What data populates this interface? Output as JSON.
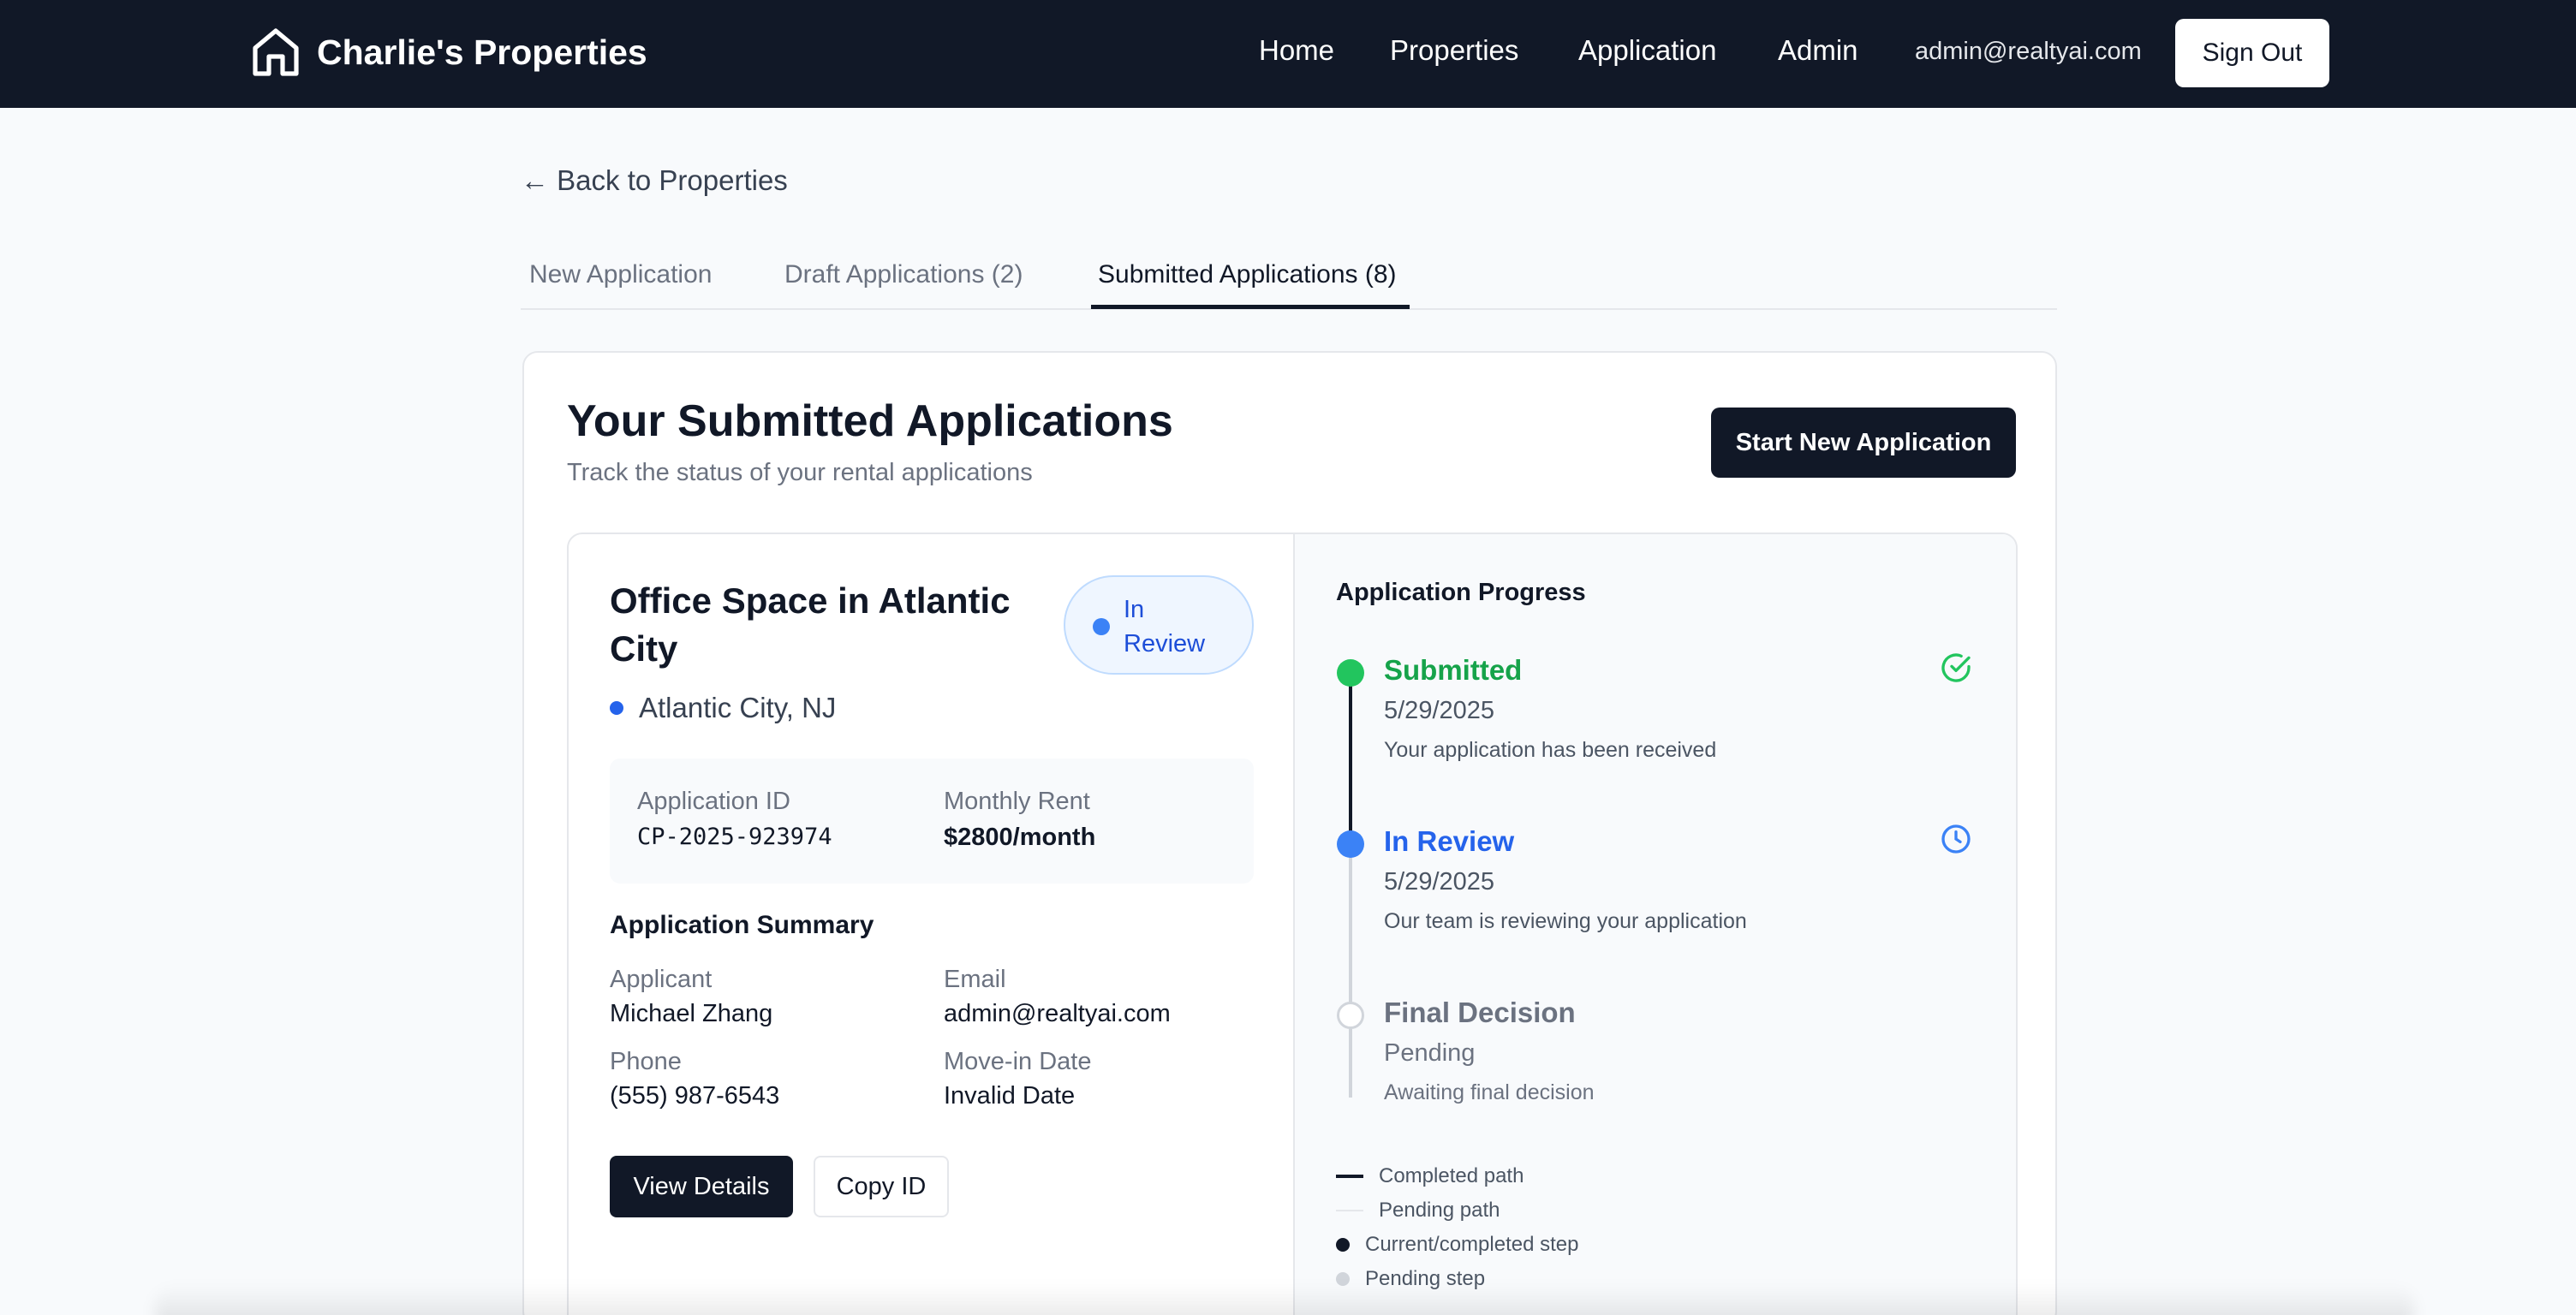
{
  "navbar": {
    "brand": "Charlie's Properties",
    "links": [
      "Home",
      "Properties",
      "Application",
      "Admin"
    ],
    "user_email": "admin@realtyai.com",
    "sign_out": "Sign Out"
  },
  "back_link": "← Back to Properties",
  "tabs": [
    {
      "label": "New Application",
      "active": false
    },
    {
      "label": "Draft Applications (2)",
      "active": false
    },
    {
      "label": "Submitted Applications (8)",
      "active": true
    }
  ],
  "page": {
    "title": "Your Submitted Applications",
    "subtitle": "Track the status of your rental applications",
    "start_button": "Start New Application"
  },
  "application": {
    "property": "Office Space in Atlantic City",
    "status": "In Review",
    "location": "Atlantic City, NJ",
    "id_label": "Application ID",
    "id_value": "CP-2025-923974",
    "rent_label": "Monthly Rent",
    "rent_value": "$2800/month",
    "summary_heading": "Application Summary",
    "applicant_label": "Applicant",
    "applicant_value": "Michael Zhang",
    "email_label": "Email",
    "email_value": "admin@realtyai.com",
    "phone_label": "Phone",
    "phone_value": "(555) 987-6543",
    "movein_label": "Move-in Date",
    "movein_value": "Invalid Date",
    "view_button": "View Details",
    "copy_button": "Copy ID"
  },
  "progress": {
    "title": "Application Progress",
    "steps": [
      {
        "title": "Submitted",
        "date": "5/29/2025",
        "description": "Your application has been received",
        "state": "completed",
        "icon": "check-circle-icon"
      },
      {
        "title": "In Review",
        "date": "5/29/2025",
        "description": "Our team is reviewing your application",
        "state": "current",
        "icon": "clock-icon"
      },
      {
        "title": "Final Decision",
        "date": "Pending",
        "description": "Awaiting final decision",
        "state": "pending",
        "icon": ""
      }
    ],
    "legend": [
      "Completed path",
      "Pending path",
      "Current/completed step",
      "Pending step"
    ]
  },
  "colors": {
    "navbar": "#111827",
    "completed": "#22c55e",
    "current": "#3b82f6",
    "pending": "#d1d5db"
  }
}
